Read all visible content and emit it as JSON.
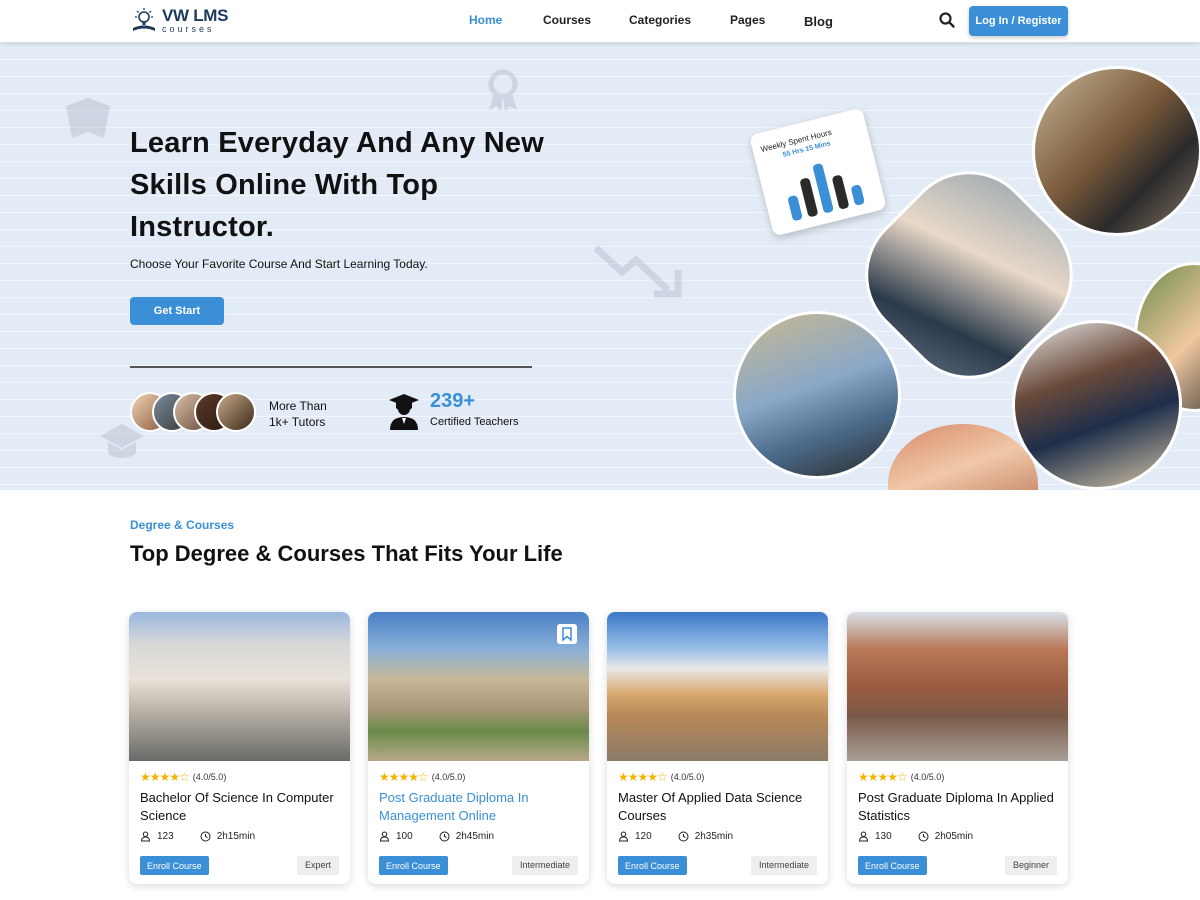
{
  "header": {
    "logo_title": "VW LMS",
    "logo_sub": "courses",
    "nav": [
      "Home",
      "Courses",
      "Categories",
      "Pages",
      "Blog"
    ],
    "active_nav": "Home",
    "login_label": "Log In / Register",
    "search_icon": "search-icon"
  },
  "hero": {
    "title": "Learn Everyday And Any New Skills Online With Top Instructor.",
    "subtitle": "Choose Your Favorite Course  And Start Learning Today.",
    "cta_label": "Get Start",
    "tutors_line1": "More Than",
    "tutors_line2": "1k+ Tutors",
    "teacher_count": "239+",
    "teacher_label": "Certified Teachers",
    "stat_card": {
      "title": "Weekly Spent Hours",
      "value": "55 Hrs 15 Mins",
      "bars": [
        0.45,
        0.7,
        0.9,
        0.6,
        0.35
      ]
    }
  },
  "section": {
    "tag": "Degree & Courses",
    "title": "Top Degree & Courses That Fits Your Life"
  },
  "courses": [
    {
      "rating_text": "(4.0/5.0)",
      "title": "Bachelor Of Science In Computer Science",
      "students": "123",
      "duration": "2h15min",
      "enroll_label": "Enroll Course",
      "level": "Expert"
    },
    {
      "rating_text": "(4.0/5.0)",
      "title": "Post Graduate Diploma In Management Online",
      "students": "100",
      "duration": "2h45min",
      "enroll_label": "Enroll Course",
      "level": "Intermediate"
    },
    {
      "rating_text": "(4.0/5.0)",
      "title": "Master Of Applied Data Science Courses",
      "students": "120",
      "duration": "2h35min",
      "enroll_label": "Enroll Course",
      "level": "Intermediate"
    },
    {
      "rating_text": "(4.0/5.0)",
      "title": "Post Graduate Diploma In Applied Statistics",
      "students": "130",
      "duration": "2h05min",
      "enroll_label": "Enroll Course",
      "level": "Beginner"
    }
  ],
  "rating_value": 4,
  "colors": {
    "accent": "#3a8fd6",
    "hero_bg": "#e3ebf6",
    "star": "#f5b301"
  }
}
